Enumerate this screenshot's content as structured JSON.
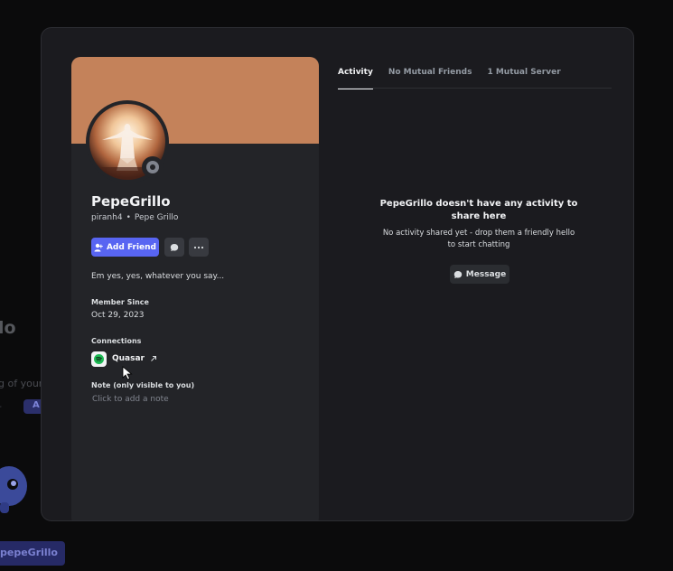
{
  "background": {
    "fragment_lo": "lo",
    "fragment_your": "g of your c",
    "fragment_dash": "-",
    "pill_label": "A",
    "button_label": "pepeGrillo"
  },
  "profile": {
    "display_name": "PepeGrillo",
    "username": "piranh4",
    "separator": "•",
    "pronoun_name": "Pepe Grillo",
    "banner_color": "#c4825a",
    "status": "offline",
    "add_friend_label": "Add Friend",
    "bio": "Em yes, yes, whatever you say...",
    "member_since_heading": "Member Since",
    "member_since": "Oct 29, 2023",
    "connections_heading": "Connections",
    "connections": [
      {
        "service": "spotify",
        "name": "Quasar",
        "icon": "spotify-icon"
      }
    ],
    "note_heading": "Note (only visible to you)",
    "note_placeholder": "Click to add a note"
  },
  "tabs": [
    {
      "label": "Activity",
      "active": true
    },
    {
      "label": "No Mutual Friends",
      "active": false
    },
    {
      "label": "1 Mutual Server",
      "active": false
    }
  ],
  "activity": {
    "empty_title": "PepeGrillo doesn't have any activity to share here",
    "empty_subtitle": "No activity shared yet - drop them a friendly hello to start chatting",
    "message_label": "Message"
  },
  "colors": {
    "accent": "#5865f2",
    "spotify": "#1db954"
  }
}
